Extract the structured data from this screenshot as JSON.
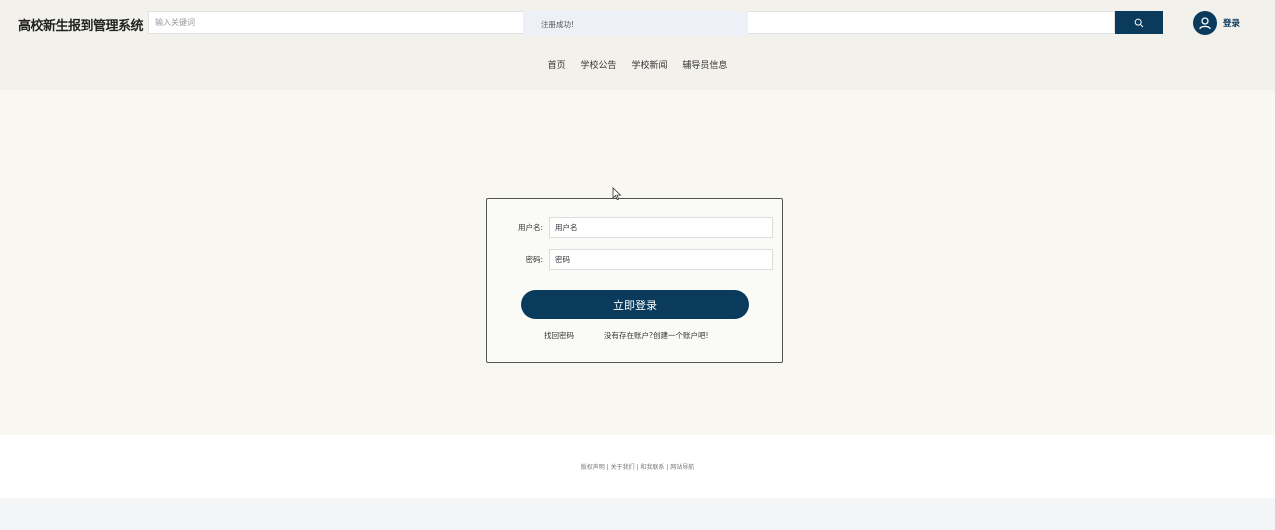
{
  "header": {
    "site_title": "高校新生报到管理系统",
    "search": {
      "placeholder": "输入关键词",
      "value": ""
    },
    "search_icon": "search-icon",
    "user_icon": "user-icon",
    "login_label": "登录"
  },
  "toast": {
    "message": "注册成功!"
  },
  "nav": {
    "items": [
      "首页",
      "学校公告",
      "学校新闻",
      "辅导员信息"
    ]
  },
  "login_form": {
    "username_label": "用户名:",
    "username_placeholder": "用户名",
    "password_label": "密码:",
    "password_placeholder": "密码",
    "submit_label": "立即登录",
    "forgot_label": "找回密码",
    "register_label": "没有存在账户?创建一个账户吧!"
  },
  "footer": {
    "text": "版权声明 | 关于我们 | 和我联系 | 网站导航"
  },
  "colors": {
    "accent": "#0a3a5c",
    "header_bg": "#f3f1ec",
    "main_bg": "#f8f7f1"
  }
}
